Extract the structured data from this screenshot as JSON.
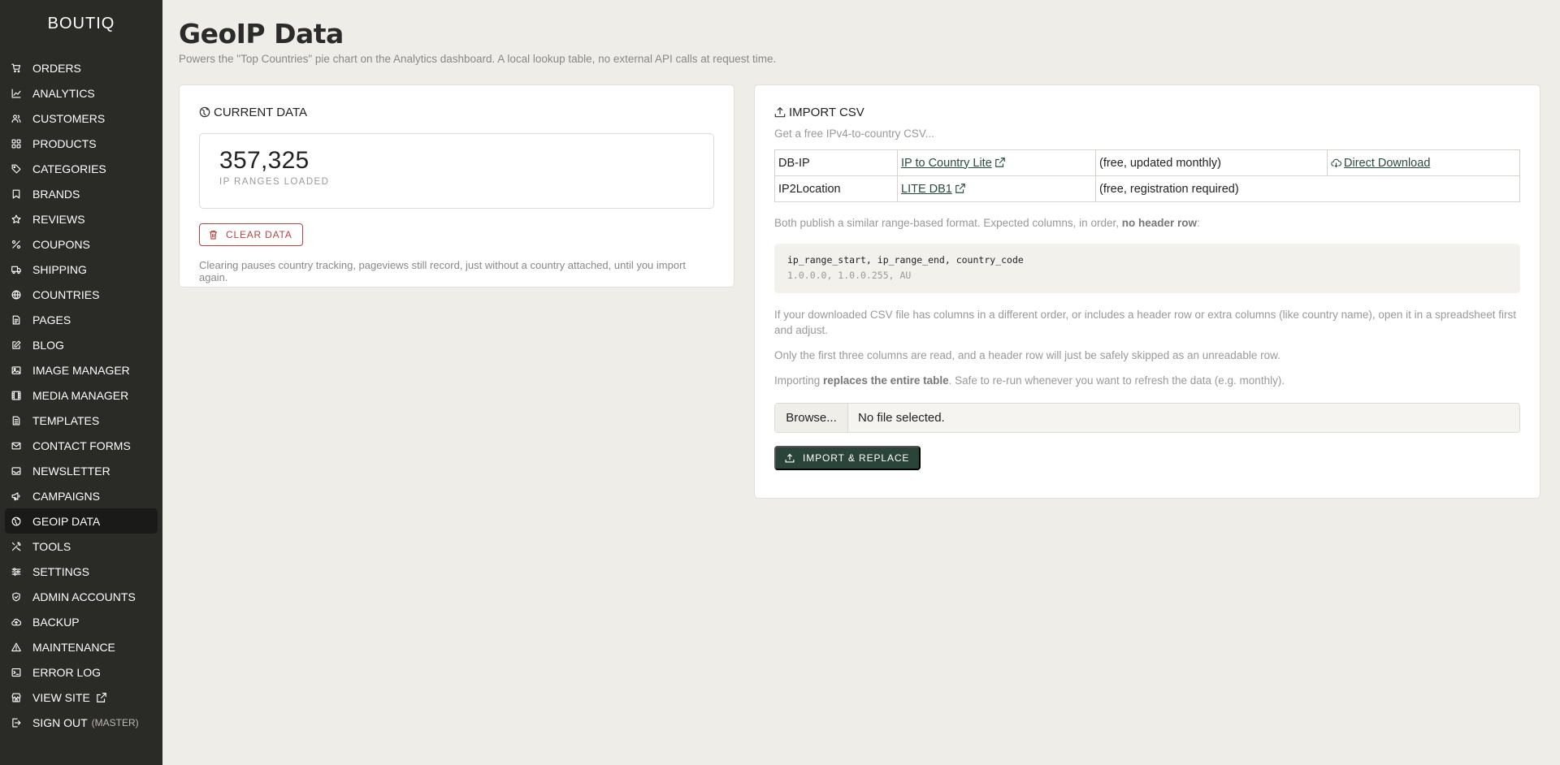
{
  "sidebar": {
    "brand": "BOUTIQ",
    "items": [
      {
        "label": "ORDERS",
        "icon": "cart-icon"
      },
      {
        "label": "ANALYTICS",
        "icon": "chart-line-icon"
      },
      {
        "label": "CUSTOMERS",
        "icon": "users-icon"
      },
      {
        "label": "PRODUCTS",
        "icon": "grid-icon"
      },
      {
        "label": "CATEGORIES",
        "icon": "tag-icon"
      },
      {
        "label": "BRANDS",
        "icon": "bookmark-icon"
      },
      {
        "label": "REVIEWS",
        "icon": "star-icon"
      },
      {
        "label": "COUPONS",
        "icon": "percent-icon"
      },
      {
        "label": "SHIPPING",
        "icon": "truck-icon"
      },
      {
        "label": "COUNTRIES",
        "icon": "globe-icon"
      },
      {
        "label": "PAGES",
        "icon": "file-icon"
      },
      {
        "label": "BLOG",
        "icon": "edit-icon"
      },
      {
        "label": "IMAGE MANAGER",
        "icon": "image-icon"
      },
      {
        "label": "MEDIA MANAGER",
        "icon": "film-icon"
      },
      {
        "label": "TEMPLATES",
        "icon": "template-icon"
      },
      {
        "label": "CONTACT FORMS",
        "icon": "mail-icon"
      },
      {
        "label": "NEWSLETTER",
        "icon": "inbox-icon"
      },
      {
        "label": "CAMPAIGNS",
        "icon": "megaphone-icon"
      },
      {
        "label": "GEOIP DATA",
        "icon": "globe-pin-icon",
        "active": true
      },
      {
        "label": "TOOLS",
        "icon": "tools-icon"
      },
      {
        "label": "SETTINGS",
        "icon": "sliders-icon"
      },
      {
        "label": "ADMIN ACCOUNTS",
        "icon": "shield-icon"
      },
      {
        "label": "BACKUP",
        "icon": "cloud-icon"
      },
      {
        "label": "MAINTENANCE",
        "icon": "warning-icon"
      },
      {
        "label": "ERROR LOG",
        "icon": "terminal-icon"
      },
      {
        "label": "VIEW SITE",
        "icon": "store-icon"
      },
      {
        "label": "SIGN OUT",
        "icon": "logout-icon",
        "extra": "(MASTER)"
      }
    ]
  },
  "header": {
    "title": "GeoIP Data",
    "subtitle": "Powers the \"Top Countries\" pie chart on the Analytics dashboard. A local lookup table, no external API calls at request time."
  },
  "current": {
    "heading": "CURRENT DATA",
    "count": "357,325",
    "count_label": "IP RANGES LOADED",
    "clear_label": "CLEAR DATA",
    "note": "Clearing pauses country tracking, pageviews still record, just without a country attached, until you import again."
  },
  "import": {
    "heading": "IMPORT CSV",
    "intro": "Get a free IPv4-to-country CSV...",
    "sources": [
      {
        "name": "DB-IP",
        "link": "IP to Country Lite",
        "desc": "(free, updated monthly)",
        "download": "Direct Download"
      },
      {
        "name": "IP2Location",
        "link": "LITE DB1",
        "desc": "(free, registration required)"
      }
    ],
    "format_pre": "Both publish a similar range-based format. Expected columns, in order, ",
    "format_bold": "no header row",
    "format_post": ":",
    "code_header": "ip_range_start, ip_range_end, country_code",
    "code_example": "1.0.0.0, 1.0.0.255, AU",
    "note1": "If your downloaded CSV file has columns in a different order, or includes a header row or extra columns (like country name), open it in a spreadsheet first and adjust.",
    "note2": "Only the first three columns are read, and a header row will just be safely skipped as an unreadable row.",
    "note3_pre": "Importing ",
    "note3_bold": "replaces the entire table",
    "note3_post": ". Safe to re-run whenever you want to refresh the data (e.g. monthly).",
    "browse_label": "Browse...",
    "file_status": "No file selected.",
    "submit_label": "IMPORT & REPLACE"
  }
}
